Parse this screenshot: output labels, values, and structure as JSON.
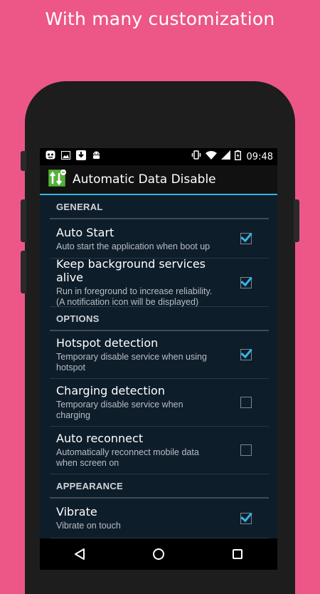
{
  "promo": {
    "title": "With many customization"
  },
  "colors": {
    "background": "#ec5788",
    "accent": "#33b5e5",
    "panel": "#0e1d2a"
  },
  "statusbar": {
    "time": "09:48",
    "left_icons": [
      "android-face-icon",
      "image-icon",
      "download-icon",
      "android-icon"
    ],
    "right_icons": [
      "vibrate-icon",
      "wifi-icon",
      "signal-icon",
      "battery-icon"
    ]
  },
  "app": {
    "title": "Automatic Data Disable",
    "icon": "app-logo-icon"
  },
  "sections": [
    {
      "header": "GENERAL",
      "items": [
        {
          "title": "Auto Start",
          "summary": "Auto start the application when boot up",
          "checked": true
        },
        {
          "title": "Keep background services alive",
          "summary": "Run in foreground to increase reliability.\n(A notification icon will be displayed)",
          "checked": true
        }
      ]
    },
    {
      "header": "OPTIONS",
      "items": [
        {
          "title": "Hotspot detection",
          "summary": "Temporary disable service when using\nhotspot",
          "checked": true
        },
        {
          "title": "Charging detection",
          "summary": "Temporary disable service when\ncharging",
          "checked": false
        },
        {
          "title": "Auto reconnect",
          "summary": "Automatically reconnect mobile data\nwhen screen on",
          "checked": false
        }
      ]
    },
    {
      "header": "APPEARANCE",
      "items": [
        {
          "title": "Vibrate",
          "summary": "Vibrate on touch",
          "checked": true
        }
      ]
    }
  ],
  "navbar": {
    "buttons": [
      "back-icon",
      "home-icon",
      "recents-icon"
    ]
  }
}
